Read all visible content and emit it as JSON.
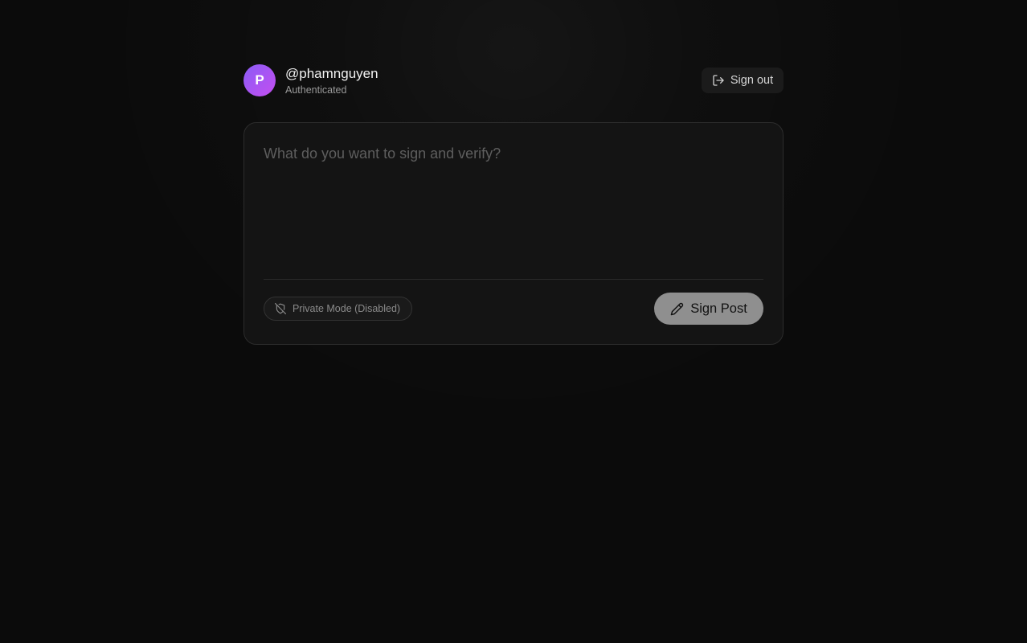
{
  "user": {
    "avatar_initial": "P",
    "username": "@phamnguyen",
    "status": "Authenticated",
    "avatar_gradient": [
      "#8b5cf6",
      "#c44ef0"
    ]
  },
  "header": {
    "signout_label": "Sign out",
    "signout_icon": "log-out-icon"
  },
  "composer": {
    "placeholder": "What do you want to sign and verify?",
    "value": "",
    "private_mode_label": "Private Mode (Disabled)",
    "private_mode_icon": "shield-off-icon",
    "private_mode_enabled": false,
    "sign_button_label": "Sign Post",
    "sign_button_icon": "pen-icon"
  },
  "colors": {
    "background": "#0b0b0b",
    "card": "#141414",
    "sign_button": "#8f8f8f"
  }
}
